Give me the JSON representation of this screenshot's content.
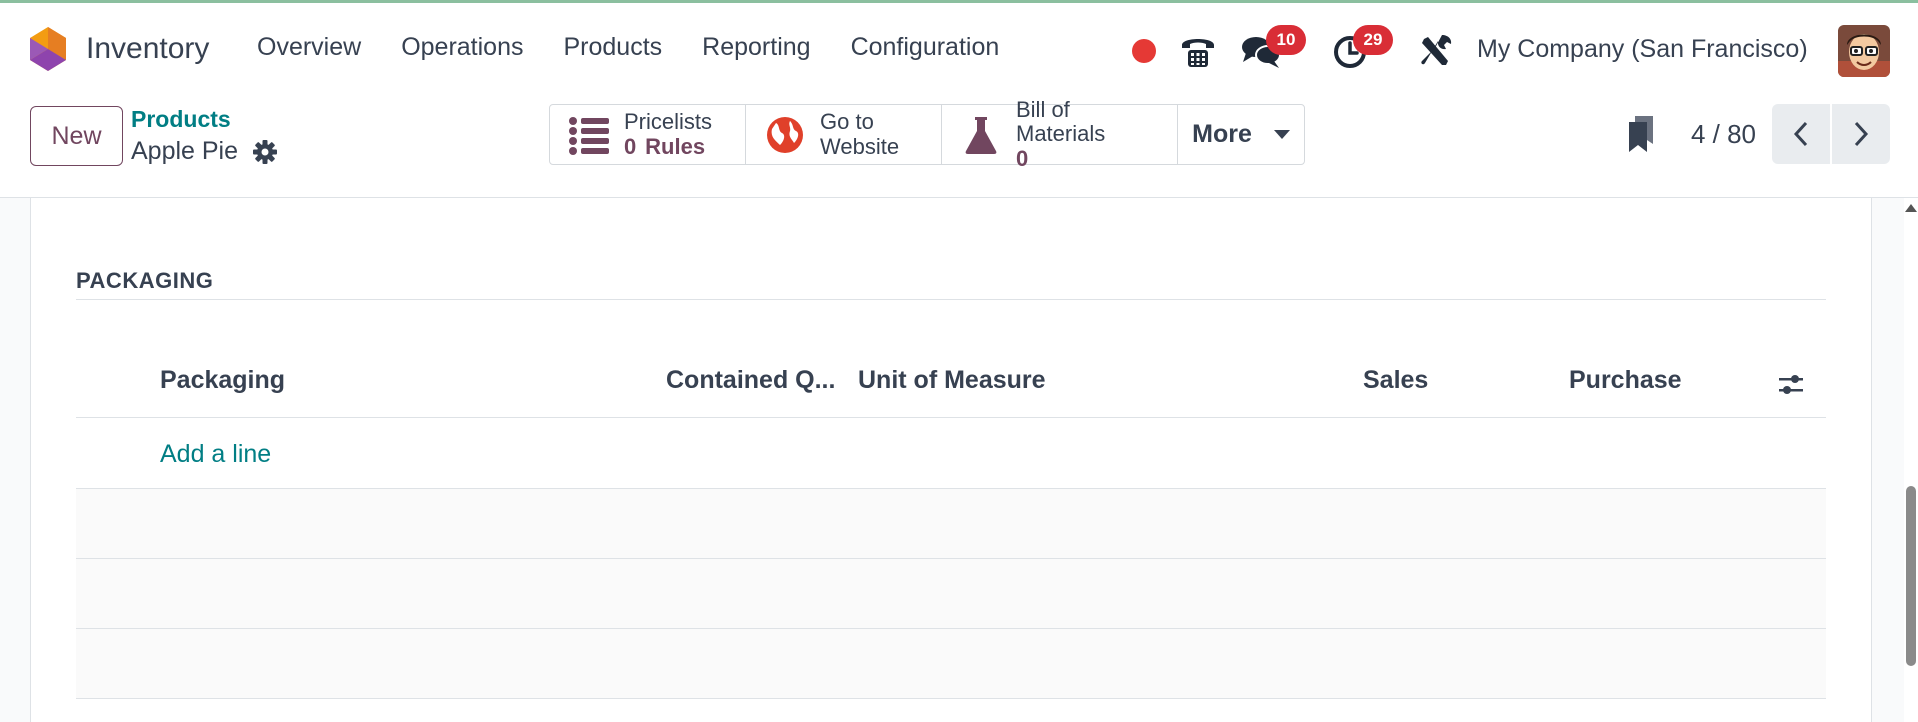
{
  "app": {
    "name": "Inventory"
  },
  "menu": [
    {
      "label": "Overview"
    },
    {
      "label": "Operations"
    },
    {
      "label": "Products"
    },
    {
      "label": "Reporting"
    },
    {
      "label": "Configuration"
    }
  ],
  "systray": {
    "messages_count": "10",
    "activities_count": "29",
    "company": "My Company (San Francisco)",
    "icons": [
      "record-dot-icon",
      "phone-icon",
      "chat-icon",
      "clock-icon",
      "tools-icon",
      "avatar"
    ]
  },
  "control": {
    "new_label": "New",
    "breadcrumb_parent": "Products",
    "breadcrumb_current": "Apple Pie",
    "pager": "4 / 80"
  },
  "smart_buttons": {
    "pricelists": {
      "title": "Pricelists",
      "value": "0",
      "sub": "Rules"
    },
    "website": {
      "line1": "Go to",
      "line2": "Website"
    },
    "bom": {
      "title": "Bill of Materials",
      "value": "0"
    },
    "more": "More"
  },
  "packaging": {
    "section_title": "PACKAGING",
    "columns": {
      "packaging": "Packaging",
      "qty": "Contained Q...",
      "uom": "Unit of Measure",
      "sales": "Sales",
      "purchase": "Purchase"
    },
    "add_line": "Add a line"
  },
  "colors": {
    "primary": "#71465f",
    "link": "#017e84",
    "badge": "#d92d36",
    "record": "#e53935"
  }
}
